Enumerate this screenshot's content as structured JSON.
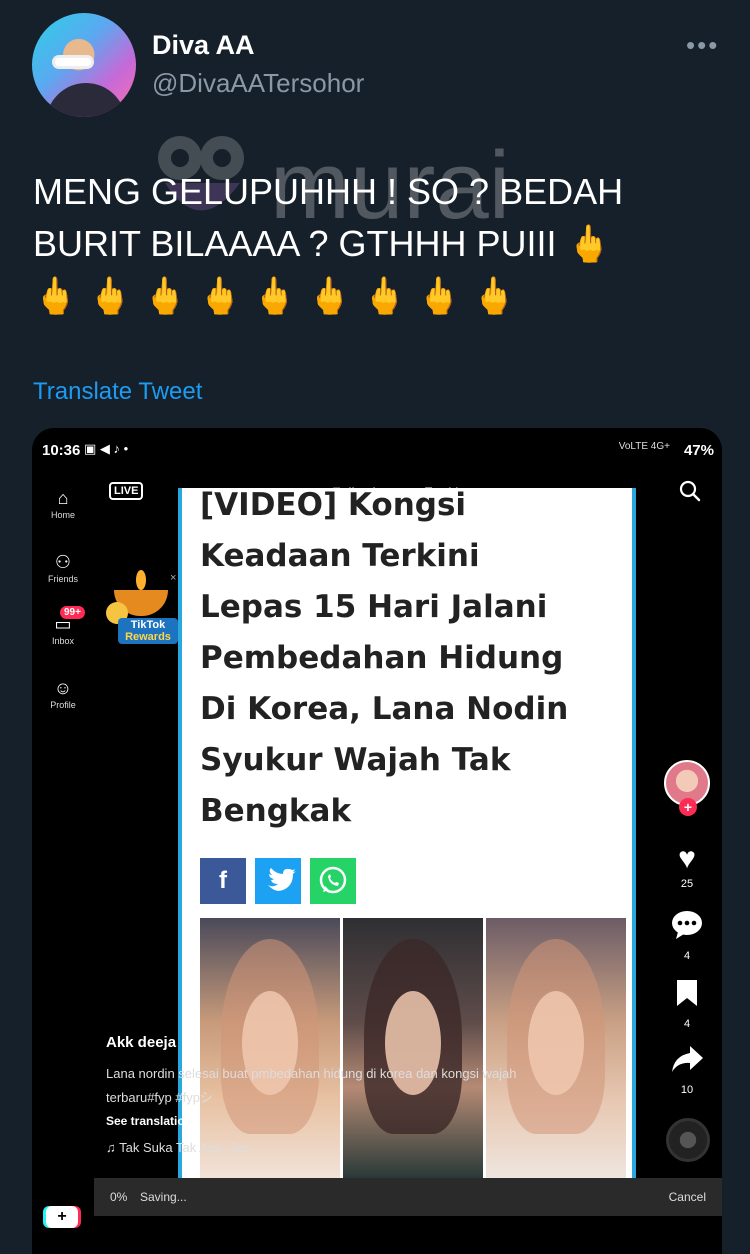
{
  "tweet": {
    "display_name": "Diva AA",
    "handle": "@DivaAATersohor",
    "text_line1": "MENG GELUPUHHH ! SO ? BEDAH",
    "text_line2": "BURIT BILAAAA ? GTHHH PUIII 🖕",
    "text_line3": "🖕 🖕 🖕 🖕 🖕 🖕 🖕 🖕 🖕",
    "translate_label": "Translate Tweet",
    "more_icon": "more-horizontal-icon",
    "watermark": "murai"
  },
  "media": {
    "status": {
      "time": "10:36",
      "left_icons": "▣ ◀ ♪ •",
      "network": "VoLTE 4G+",
      "battery": "47%"
    },
    "topnav": {
      "following": "Following",
      "for_you": "For You"
    },
    "live_label": "LIVE",
    "rail": {
      "home": "Home",
      "friends": "Friends",
      "inbox": "Inbox",
      "inbox_badge": "99+",
      "profile": "Profile"
    },
    "rewards": {
      "line1": "TikTok",
      "line2": "Rewards"
    },
    "article": {
      "title_lines": [
        "[VIDEO] Kongsi",
        "Keadaan Terkini",
        "Lepas 15 Hari Jalani",
        "Pembedahan Hidung",
        "Di Korea, Lana Nodin",
        "Syukur Wajah Tak",
        "Bengkak"
      ],
      "share": {
        "fb": "f",
        "tw": "t",
        "wa": "w"
      }
    },
    "actions": {
      "likes": "25",
      "comments": "4",
      "saves": "4",
      "shares": "10"
    },
    "caption": {
      "user": "Akk deeja",
      "desc_line1": "Lana nordin selesai buat pmbedahan hidung di korea dan kongsi wajah",
      "desc_line2": "terbaru#fyp #fypシ",
      "see_translation": "See translatio",
      "music": "♫ Tak Suka Tak Apa_Scr..."
    },
    "savebar": {
      "percent": "0%",
      "saving": "Saving...",
      "cancel": "Cancel"
    }
  }
}
